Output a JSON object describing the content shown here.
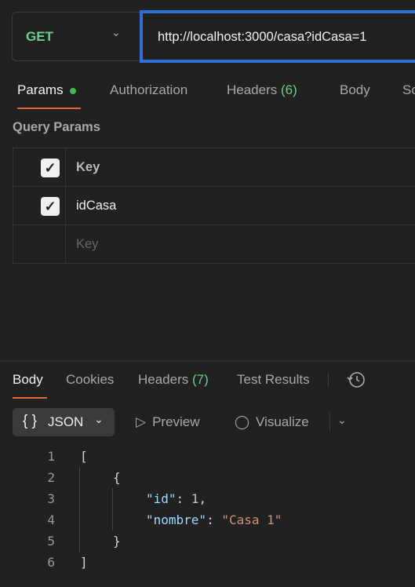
{
  "request": {
    "method": "GET",
    "url": "http://localhost:3000/casa?idCasa=1"
  },
  "req_tabs": {
    "params": "Params",
    "authorization": "Authorization",
    "headers": "Headers",
    "headers_count": "(6)",
    "body": "Body",
    "scripts": "Sc"
  },
  "query_params": {
    "title": "Query Params",
    "header_key": "Key",
    "rows": [
      {
        "key": "idCasa",
        "checked": true
      }
    ],
    "placeholder_key": "Key"
  },
  "resp_tabs": {
    "body": "Body",
    "cookies": "Cookies",
    "headers": "Headers",
    "headers_count": "(7)",
    "test_results": "Test Results"
  },
  "resp_toolbar": {
    "format": "JSON",
    "format_icon": "{ }",
    "preview": "Preview",
    "visualize": "Visualize"
  },
  "code": {
    "line_numbers": [
      "1",
      "2",
      "3",
      "4",
      "5",
      "6"
    ],
    "l1": "[",
    "l2": "{",
    "k_id": "\"id\"",
    "v_id": "1",
    "k_nombre": "\"nombre\"",
    "v_nombre": "\"Casa 1\"",
    "l5": "}",
    "l6": "]",
    "colon": ": ",
    "comma": ","
  },
  "colors": {
    "accent": "#e0683f",
    "method": "#6bd08a",
    "url_focus": "#2f6fd6"
  }
}
